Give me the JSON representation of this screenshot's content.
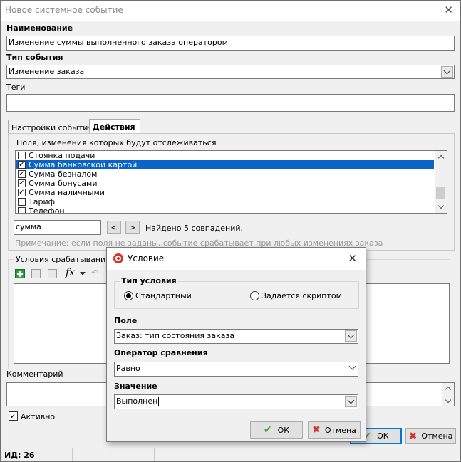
{
  "window": {
    "title": "Новое системное событие",
    "close_glyph": "✕"
  },
  "name_label": "Наименование",
  "name_value": "Изменение суммы выполненного заказа оператором",
  "event_type_label": "Тип события",
  "event_type_value": "Изменение заказа",
  "tags_label": "Теги",
  "tags_value": "",
  "tabs": [
    {
      "label": "Настройки события",
      "active": false
    },
    {
      "label": "Действия",
      "active": true
    }
  ],
  "fields_label": "Поля, изменения которых будут отслеживаться",
  "fields_list": [
    {
      "label": "Стоянка подачи",
      "checked": false,
      "selected": false
    },
    {
      "label": "Сумма банковской картой",
      "checked": true,
      "selected": true
    },
    {
      "label": "Сумма безналом",
      "checked": true,
      "selected": false
    },
    {
      "label": "Сумма бонусами",
      "checked": true,
      "selected": false
    },
    {
      "label": "Сумма наличными",
      "checked": true,
      "selected": false
    },
    {
      "label": "Тариф",
      "checked": false,
      "selected": false
    },
    {
      "label": "Телефон",
      "checked": false,
      "selected": false
    }
  ],
  "search": {
    "value": "сумма",
    "prev": "<",
    "next": ">",
    "result": "Найдено 5 совпадений."
  },
  "note": "Примечание: если поля не заданы, событие срабатывает при любых изменениях заказа",
  "trigger_label": "Условия срабатывания",
  "fx_label": "fx",
  "comment_label": "Комментарий",
  "comment_value": "",
  "active_label": "Активно",
  "active_checked": true,
  "ok_label": "ОК",
  "cancel_label": "Отмена",
  "status_id": "ИД: 26",
  "dialog": {
    "title": "Условие",
    "close_glyph": "✕",
    "cond_type_label": "Тип условия",
    "radio_standard": "Стандартный",
    "radio_script": "Задается скриптом",
    "field_label": "Поле",
    "field_value": "Заказ: тип состояния заказа",
    "operator_label": "Оператор сравнения",
    "operator_value": "Равно",
    "value_label": "Значение",
    "value_value": "Выполнен",
    "ok_label": "ОК",
    "cancel_label": "Отмена"
  },
  "colors": {
    "selection": "#0a64c8",
    "default_border": "#0078d7",
    "ok_green": "#3ea33e",
    "cancel_red": "#d9302c"
  }
}
